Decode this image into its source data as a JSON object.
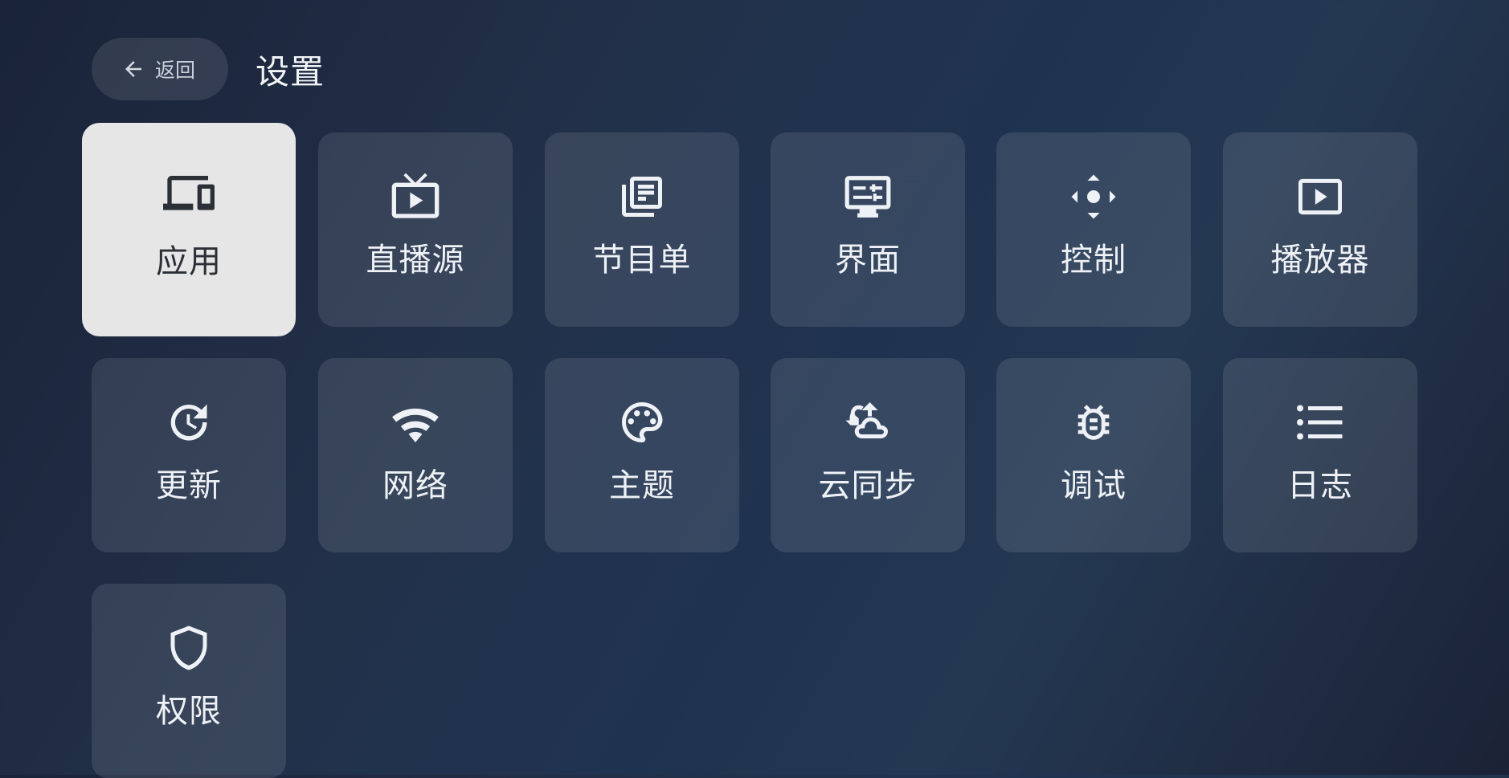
{
  "header": {
    "back_label": "返回",
    "back_icon": "arrow-left-icon",
    "title": "设置"
  },
  "colors": {
    "tile_bg": "#394a63",
    "tile_focused_bg": "#e6e6e6",
    "text": "#eef1f5",
    "text_focused": "#2b2f36"
  },
  "tiles": [
    {
      "label": "应用",
      "icon": "devices-icon",
      "focused": true
    },
    {
      "label": "直播源",
      "icon": "live-tv-icon",
      "focused": false
    },
    {
      "label": "节目单",
      "icon": "library-books-icon",
      "focused": false
    },
    {
      "label": "界面",
      "icon": "display-settings-icon",
      "focused": false
    },
    {
      "label": "控制",
      "icon": "control-dpad-icon",
      "focused": false
    },
    {
      "label": "播放器",
      "icon": "play-box-icon",
      "focused": false
    },
    {
      "label": "更新",
      "icon": "update-icon",
      "focused": false
    },
    {
      "label": "网络",
      "icon": "wifi-icon",
      "focused": false
    },
    {
      "label": "主题",
      "icon": "palette-icon",
      "focused": false
    },
    {
      "label": "云同步",
      "icon": "cloud-sync-icon",
      "focused": false
    },
    {
      "label": "调试",
      "icon": "bug-icon",
      "focused": false
    },
    {
      "label": "日志",
      "icon": "list-icon",
      "focused": false
    },
    {
      "label": "权限",
      "icon": "shield-icon",
      "focused": false
    }
  ]
}
